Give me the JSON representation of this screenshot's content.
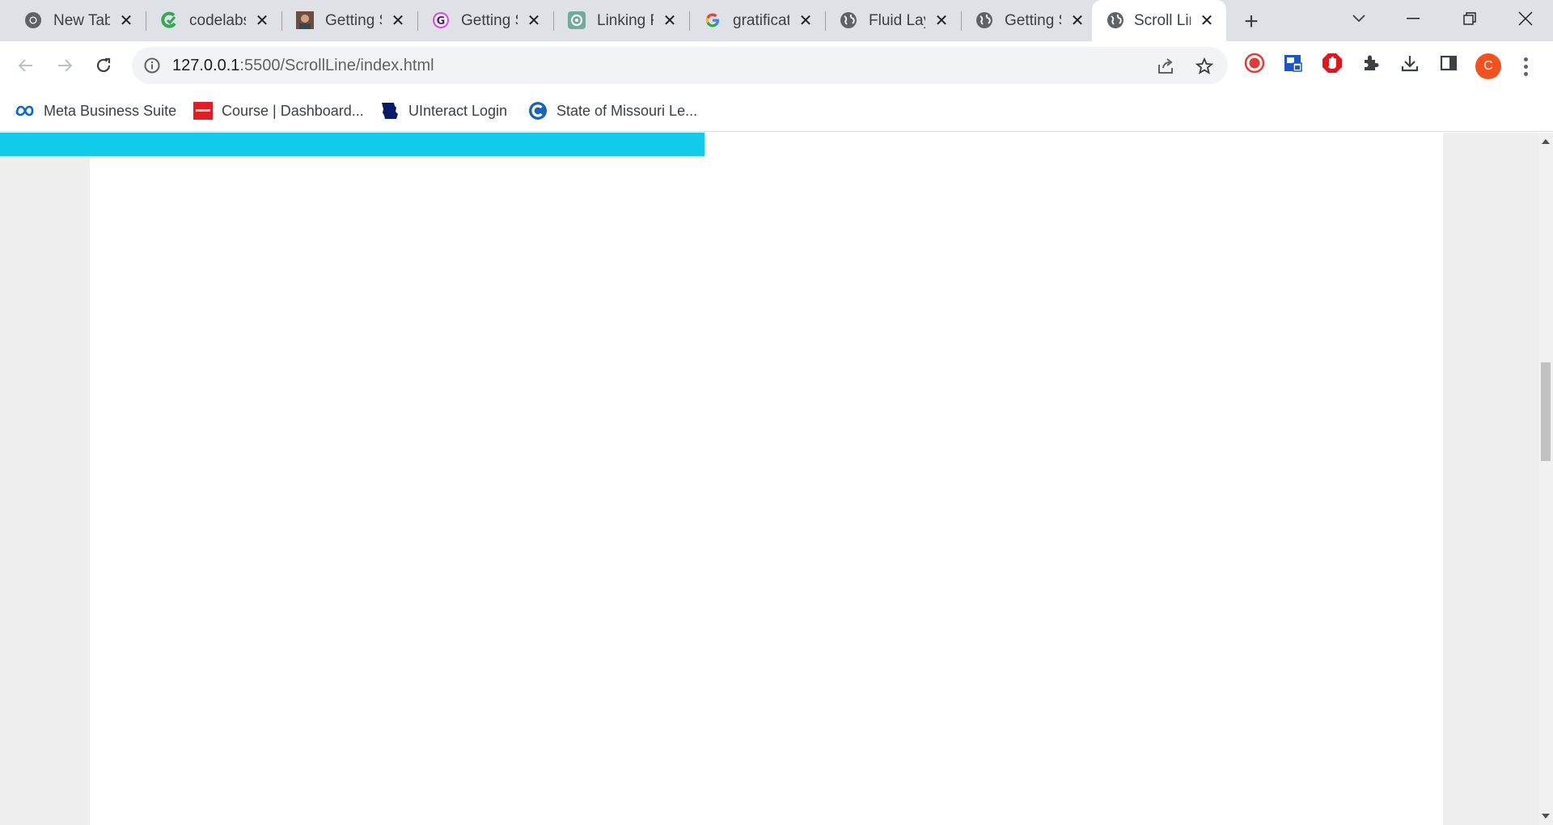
{
  "browser": {
    "tabs": [
      {
        "title": "New Tab",
        "icon": "chrome-icon",
        "active": false
      },
      {
        "title": "codelabs",
        "icon": "codelabs-icon",
        "active": false
      },
      {
        "title": "Getting S",
        "icon": "profile-photo-icon",
        "active": false
      },
      {
        "title": "Getting S",
        "icon": "g-circle-icon",
        "active": false
      },
      {
        "title": "Linking F",
        "icon": "openai-icon",
        "active": false
      },
      {
        "title": "gratificat",
        "icon": "google-icon",
        "active": false
      },
      {
        "title": "Fluid Lay",
        "icon": "globe-icon",
        "active": false
      },
      {
        "title": "Getting S",
        "icon": "globe-icon",
        "active": false
      },
      {
        "title": "Scroll Lin",
        "icon": "globe-icon",
        "active": true
      }
    ],
    "url_host": "127.0.0.1",
    "url_path": ":5500/ScrollLine/index.html",
    "profile_initial": "C",
    "bookmarks": [
      {
        "label": "Meta Business Suite",
        "icon": "meta-icon"
      },
      {
        "label": "Course | Dashboard...",
        "icon": "ec-council-icon"
      },
      {
        "label": "UInteract Login",
        "icon": "missouri-state-icon"
      },
      {
        "label": "State of Missouri Le...",
        "icon": "c-logo-icon"
      }
    ]
  },
  "page": {
    "scroll_progress_percent": 45.8,
    "progress_color": "#11cbea"
  },
  "scrollbar": {
    "position_fraction": 0.38,
    "visible_fraction": 0.15
  },
  "colors": {
    "tabstrip": "#dee1e6",
    "accent_progress": "#11cbea",
    "avatar": "#f4511e"
  }
}
